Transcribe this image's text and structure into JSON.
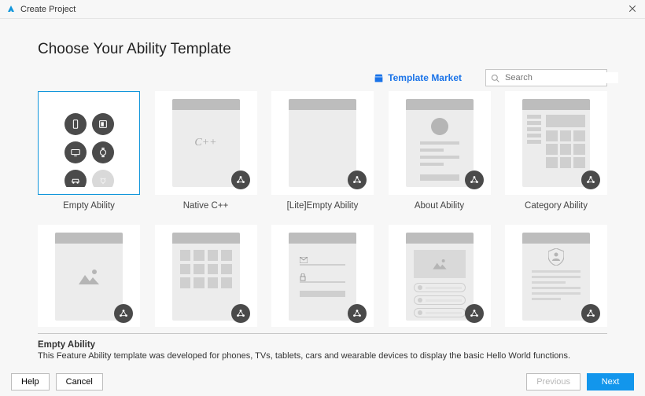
{
  "window": {
    "title": "Create Project"
  },
  "page_heading": "Choose Your Ability Template",
  "market_link": "Template Market",
  "search": {
    "placeholder": "Search"
  },
  "templates": [
    {
      "label": "Empty Ability",
      "selected": true,
      "description_title": "Empty Ability",
      "description_text": "This Feature Ability template was developed for phones, TVs, tablets, cars and wearable devices to display the basic Hello World functions."
    },
    {
      "label": "Native C++"
    },
    {
      "label": "[Lite]Empty Ability"
    },
    {
      "label": "About Ability"
    },
    {
      "label": "Category Ability"
    },
    {
      "label": ""
    },
    {
      "label": ""
    },
    {
      "label": ""
    },
    {
      "label": ""
    },
    {
      "label": ""
    }
  ],
  "native_cpp_text": "C++",
  "footer": {
    "help": "Help",
    "cancel": "Cancel",
    "previous": "Previous",
    "next": "Next"
  }
}
